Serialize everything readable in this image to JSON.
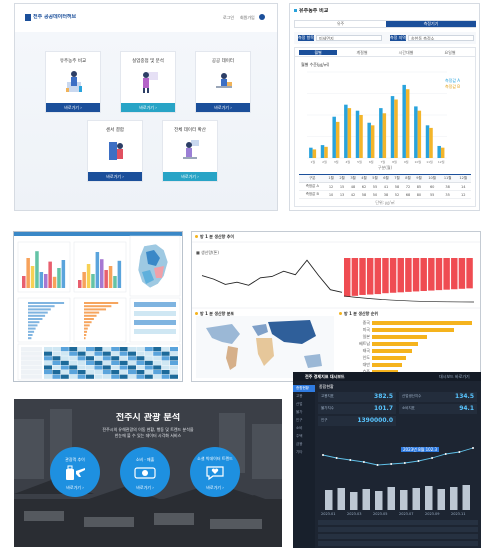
{
  "panel1": {
    "logo_text": "전주 공공데이터허브",
    "header_links": [
      "로그인",
      "회원가입"
    ],
    "cards": [
      {
        "title": "유주농주 비교",
        "button": "바로가기  ›",
        "color": "#1b4f9a"
      },
      {
        "title": "실업중점 및 분석",
        "button": "바로가기  ›",
        "color": "#28a4c6"
      },
      {
        "title": "공공 데이터",
        "button": "바로가기  ›",
        "color": "#1b4f9a"
      },
      {
        "title": "센서 결합",
        "button": "바로가기  ›",
        "color": "#1b4f9a"
      },
      {
        "title": "전체 데이터 확산",
        "button": "바로가기  ›",
        "color": "#28a4c6"
      }
    ]
  },
  "panel2": {
    "title": "유주농주 비교",
    "tabs": [
      "유주",
      "측정기기"
    ],
    "selects": [
      "측정 항목",
      "미세먼지",
      "측정 지역",
      "송천동 측정소"
    ],
    "subtabs": [
      "월별",
      "계절별",
      "시간대별",
      "요일별"
    ],
    "chart_title": "월별 수준(㎍/㎥)",
    "legend": [
      "측정값 A",
      "측정값 B"
    ],
    "xlabel": "구분(월)",
    "table_headers": [
      "구분",
      "1월",
      "2월",
      "3월",
      "4월",
      "5월",
      "6월",
      "7월",
      "8월",
      "9월",
      "10월",
      "11월",
      "12월"
    ],
    "table_rows": [
      [
        "측정값 A",
        "12",
        "15",
        "48",
        "62",
        "55",
        "41",
        "58",
        "72",
        "85",
        "60",
        "38",
        "14"
      ],
      [
        "측정값 B",
        "10",
        "13",
        "42",
        "58",
        "50",
        "38",
        "52",
        "68",
        "80",
        "55",
        "35",
        "12"
      ]
    ],
    "footnote": "단위: ㎍/㎥",
    "chart_data": {
      "type": "bar",
      "categories": [
        "1월",
        "2월",
        "3월",
        "4월",
        "5월",
        "6월",
        "7월",
        "8월",
        "9월",
        "10월",
        "11월",
        "12월"
      ],
      "series": [
        {
          "name": "측정값 A",
          "values": [
            12,
            15,
            48,
            62,
            55,
            41,
            58,
            72,
            85,
            60,
            38,
            14
          ],
          "color": "#29a3dc"
        },
        {
          "name": "측정값 B",
          "values": [
            10,
            13,
            42,
            58,
            50,
            38,
            52,
            68,
            80,
            55,
            35,
            12
          ],
          "color": "#f3b52a"
        }
      ],
      "ylim": [
        0,
        100
      ]
    }
  },
  "panel3": {
    "chart_data": [
      {
        "type": "bar",
        "values": [
          30,
          75,
          55,
          92,
          40,
          35,
          66,
          28,
          50,
          70
        ],
        "colors": [
          "#e85f6e",
          "#f7a25b",
          "#f7d154",
          "#64c3a6",
          "#5aa4dc",
          "#a678d2",
          "#e85f6e",
          "#f7a25b",
          "#64c3a6",
          "#5aa4dc"
        ]
      },
      {
        "type": "bar",
        "values": [
          20,
          40,
          60,
          35,
          90,
          72,
          45,
          55,
          30,
          68
        ],
        "colors": [
          "#e85f6e",
          "#f7a25b",
          "#f7d154",
          "#64c3a6",
          "#5aa4dc",
          "#a678d2",
          "#e85f6e",
          "#f7a25b",
          "#64c3a6",
          "#5aa4dc"
        ]
      }
    ],
    "hbars": [
      95,
      70,
      60,
      52,
      45,
      38,
      30,
      25,
      20,
      16,
      12,
      9
    ],
    "hbars2": [
      90,
      72,
      58,
      40,
      33,
      26,
      20,
      15,
      10,
      8,
      6,
      4
    ],
    "colors": {
      "accent": "#3a88c7",
      "heat_high": "#1d6a9a",
      "heat_low": "#cfe7f3"
    }
  },
  "panel4": {
    "section_titles": [
      "방 1 분 생산량 추이",
      "방 1 분 생산량 분포",
      "방 1 분 생산량 순위"
    ],
    "legend_caption": "■ 생산량(톤)",
    "chart_data": [
      {
        "type": "line",
        "values": [
          60,
          52,
          40,
          45,
          38,
          55,
          58,
          70,
          62,
          95,
          60,
          28,
          22
        ]
      },
      {
        "type": "bar",
        "values": [
          88,
          86,
          84,
          83,
          82,
          80,
          79,
          78,
          77,
          76,
          75,
          74,
          73,
          72,
          71,
          70,
          69
        ]
      },
      {
        "type": "bar",
        "categories": [
          "중국",
          "미국",
          "일본",
          "베트남",
          "태국",
          "인도",
          "대만",
          "호주"
        ],
        "values": [
          100,
          82,
          55,
          46,
          40,
          34,
          30,
          26
        ]
      }
    ],
    "colors": {
      "line": "#222222",
      "bar_red": "#ef4c52",
      "bar_yellow": "#f5b31d",
      "title_dot": "#f5b31d"
    }
  },
  "panel5": {
    "title": "전주시 관광 분석",
    "subtitle_lines": [
      "전주시의 유해관광의 이동 현황, 행동 및 트렌드 분석을",
      "한눈에 볼 수 있는 데이터 시각화 서비스"
    ],
    "circles": [
      {
        "label": "관광객 추이",
        "link": "바로가기 ›",
        "icon": "luggage-plane-icon"
      },
      {
        "label": "소비 · 매출",
        "link": "바로가기 ›",
        "icon": "money-icon"
      },
      {
        "label": "소셜 빅데이터 트렌드",
        "link": "바로가기 ›",
        "icon": "heart-chat-icon"
      }
    ],
    "colors": {
      "circle": "#1e90e0"
    }
  },
  "panel6": {
    "header": "전주 경제지표 대시보드",
    "header_right": "대시보드 바로가기",
    "sidebar": [
      "종합현황",
      "고용",
      "산업",
      "물가",
      "인구",
      "소비",
      "주택",
      "금융",
      "기타"
    ],
    "section_label": "종합현황",
    "kpis": [
      {
        "label": "고용지표",
        "value": "382.5"
      },
      {
        "label": "산업생산지수",
        "value": "134.5"
      },
      {
        "label": "물가지수",
        "value": "101.7"
      },
      {
        "label": "소비지표",
        "value": "94.1"
      },
      {
        "label": "인구",
        "value": "1390000.0"
      }
    ],
    "chart_labels": [
      "2023.01",
      "2023.03",
      "2023.05",
      "2023.07",
      "2023.09",
      "2023.11"
    ],
    "tooltip": "2023년 8월 102.3",
    "chart_data": [
      {
        "type": "line",
        "values": [
          55,
          52,
          50,
          48,
          45,
          46,
          47,
          49,
          52,
          56,
          58,
          62
        ],
        "color": "#5fc0e8"
      },
      {
        "type": "bar",
        "values": [
          20,
          22,
          18,
          21,
          19,
          23,
          20,
          22,
          24,
          21,
          23,
          25
        ],
        "color": "#d8e4f0"
      }
    ],
    "colors": {
      "accent": "#2f7be0",
      "value": "#58c5ff"
    }
  }
}
